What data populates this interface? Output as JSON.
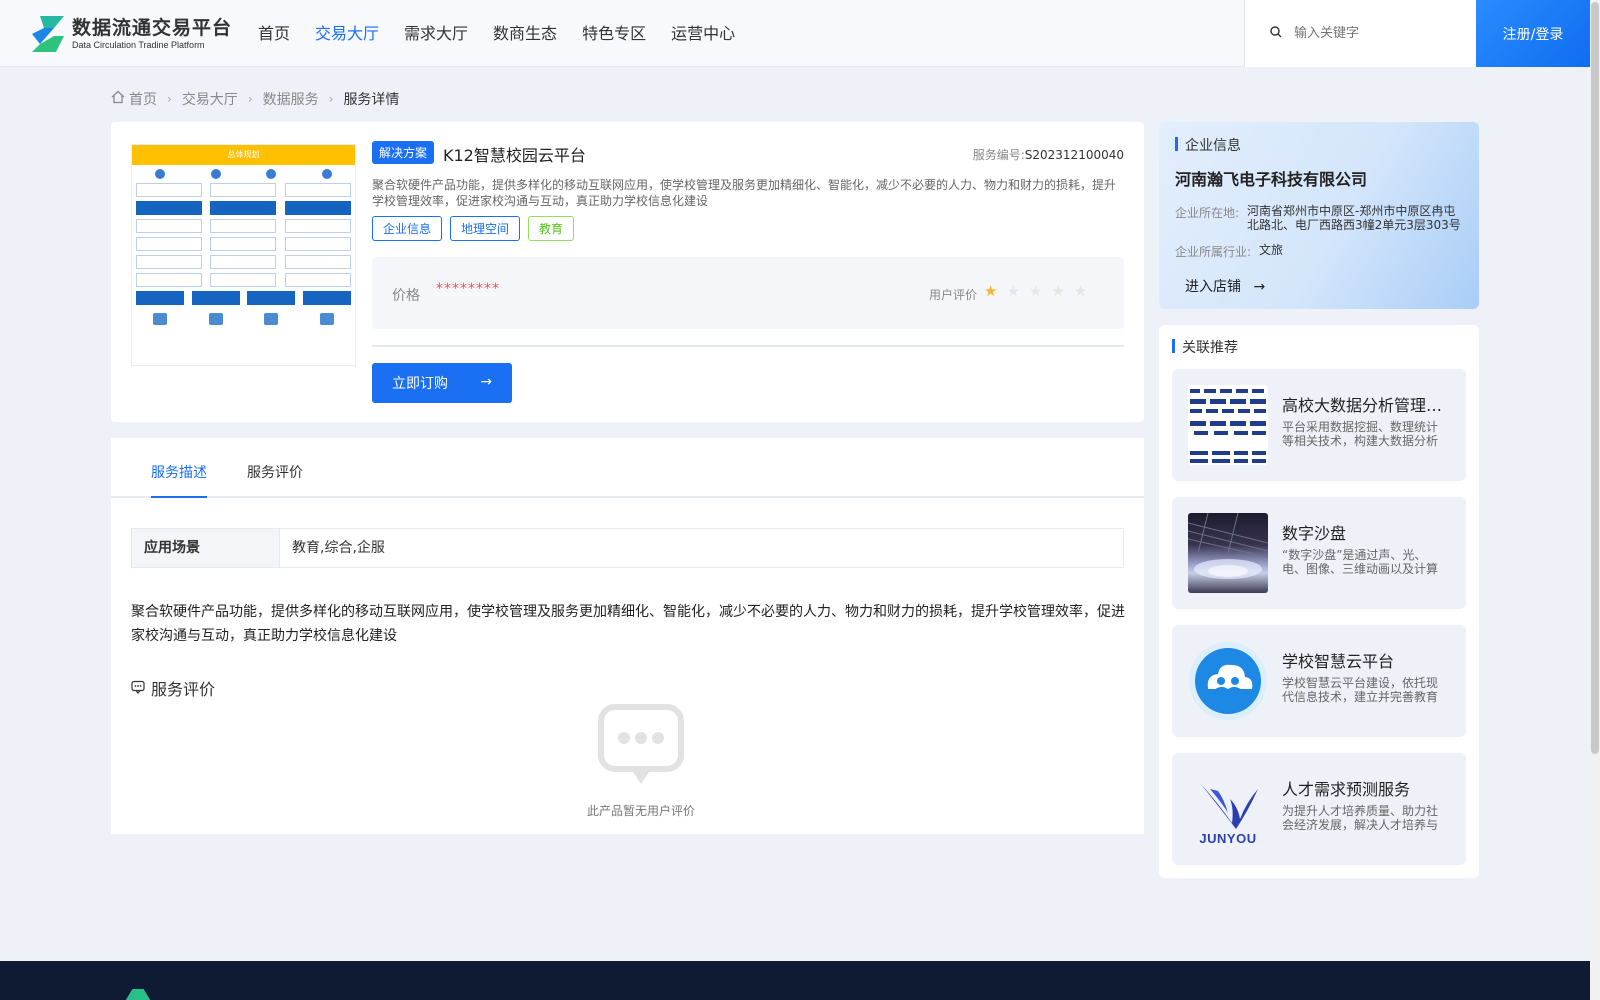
{
  "header": {
    "logo_cn": "数据流通交易平台",
    "logo_en": "Data Circulation Tradine Platform",
    "nav": [
      "首页",
      "交易大厅",
      "需求大厅",
      "数商生态",
      "特色专区",
      "运营中心"
    ],
    "nav_active": "交易大厅",
    "search_placeholder": "输入关键字",
    "login": "注册/登录"
  },
  "breadcrumb": [
    "首页",
    "交易大厅",
    "数据服务",
    "服务详情"
  ],
  "product": {
    "badge": "解决方案",
    "title": "K12智慧校园云平台",
    "service_no_label": "服务编号:",
    "service_no": "S202312100040",
    "desc": "聚合软硬件产品功能，提供多样化的移动互联网应用，使学校管理及服务更加精细化、智能化，减少不必要的人力、物力和财力的损耗，提升学校管理效率，促进家校沟通与互动，真正助力学校信息化建设",
    "tags": [
      "企业信息",
      "地理空间",
      "教育"
    ],
    "price_label": "价格",
    "price": "********",
    "rating_label": "用户评价",
    "rating": 1,
    "rating_max": 5,
    "buy_label": "立即订购",
    "image_title": "总体规划"
  },
  "tabs": [
    "服务描述",
    "服务评价"
  ],
  "tab_active": "服务描述",
  "detail": {
    "scene_label": "应用场景",
    "scene_value": "教育,综合,企服",
    "description": "聚合软硬件产品功能，提供多样化的移动互联网应用，使学校管理及服务更加精细化、智能化，减少不必要的人力、物力和财力的损耗，提升学校管理效率，促进家校沟通与互动，真正助力学校信息化建设",
    "review_heading": "服务评价",
    "empty_review": "此产品暂无用户评价"
  },
  "company": {
    "section_title": "企业信息",
    "name": "河南瀚飞电子科技有限公司",
    "location_label": "企业所在地:",
    "location": "河南省郑州市中原区-郑州市中原区冉屯北路北、电厂西路西3幢2单元3层303号",
    "industry_label": "企业所属行业:",
    "industry": "文旅",
    "enter_shop": "进入店铺"
  },
  "recommend": {
    "section_title": "关联推荐",
    "items": [
      {
        "title": "高校大数据分析管理平台",
        "desc": "平台采用数据挖掘、数理统计等相关技术，构建大数据分析框架"
      },
      {
        "title": "数字沙盘",
        "desc": "“数字沙盘”是通过声、光、电、图像、三维动画以及计算机程控技术"
      },
      {
        "title": "学校智慧云平台",
        "desc": "学校智慧云平台建设，依托现代信息技术，建立并完善教育管理体系"
      },
      {
        "title": "人才需求预测服务",
        "desc": "为提升人才培养质量、助力社会经济发展，解决人才培养与需求"
      }
    ],
    "logo_text": "JUNYOU"
  }
}
